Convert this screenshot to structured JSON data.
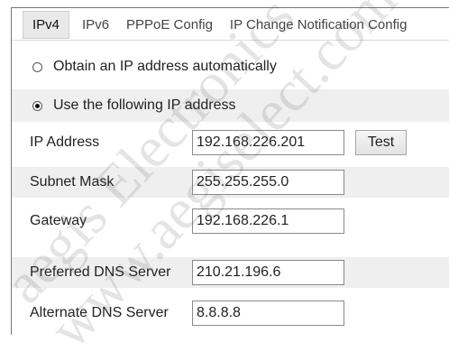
{
  "tabs": [
    {
      "label": "IPv4",
      "active": true
    },
    {
      "label": "IPv6",
      "active": false
    },
    {
      "label": "PPPoE Config",
      "active": false
    },
    {
      "label": "IP Change Notification Config",
      "active": false
    }
  ],
  "ip_mode": {
    "auto_label": "Obtain an IP address automatically",
    "auto_selected": false,
    "manual_label": "Use the following IP address",
    "manual_selected": true
  },
  "fields": {
    "ip_address": {
      "label": "IP Address",
      "value": "192.168.226.201"
    },
    "subnet_mask": {
      "label": "Subnet Mask",
      "value": "255.255.255.0"
    },
    "gateway": {
      "label": "Gateway",
      "value": "192.168.226.1"
    },
    "preferred_dns": {
      "label": "Preferred DNS Server",
      "value": "210.21.196.6"
    },
    "alternate_dns": {
      "label": "Alternate DNS Server",
      "value": "8.8.8.8"
    }
  },
  "buttons": {
    "test_label": "Test"
  },
  "watermark": {
    "line1": "aegis Electronics",
    "line2": "www.aegiselect.com"
  }
}
